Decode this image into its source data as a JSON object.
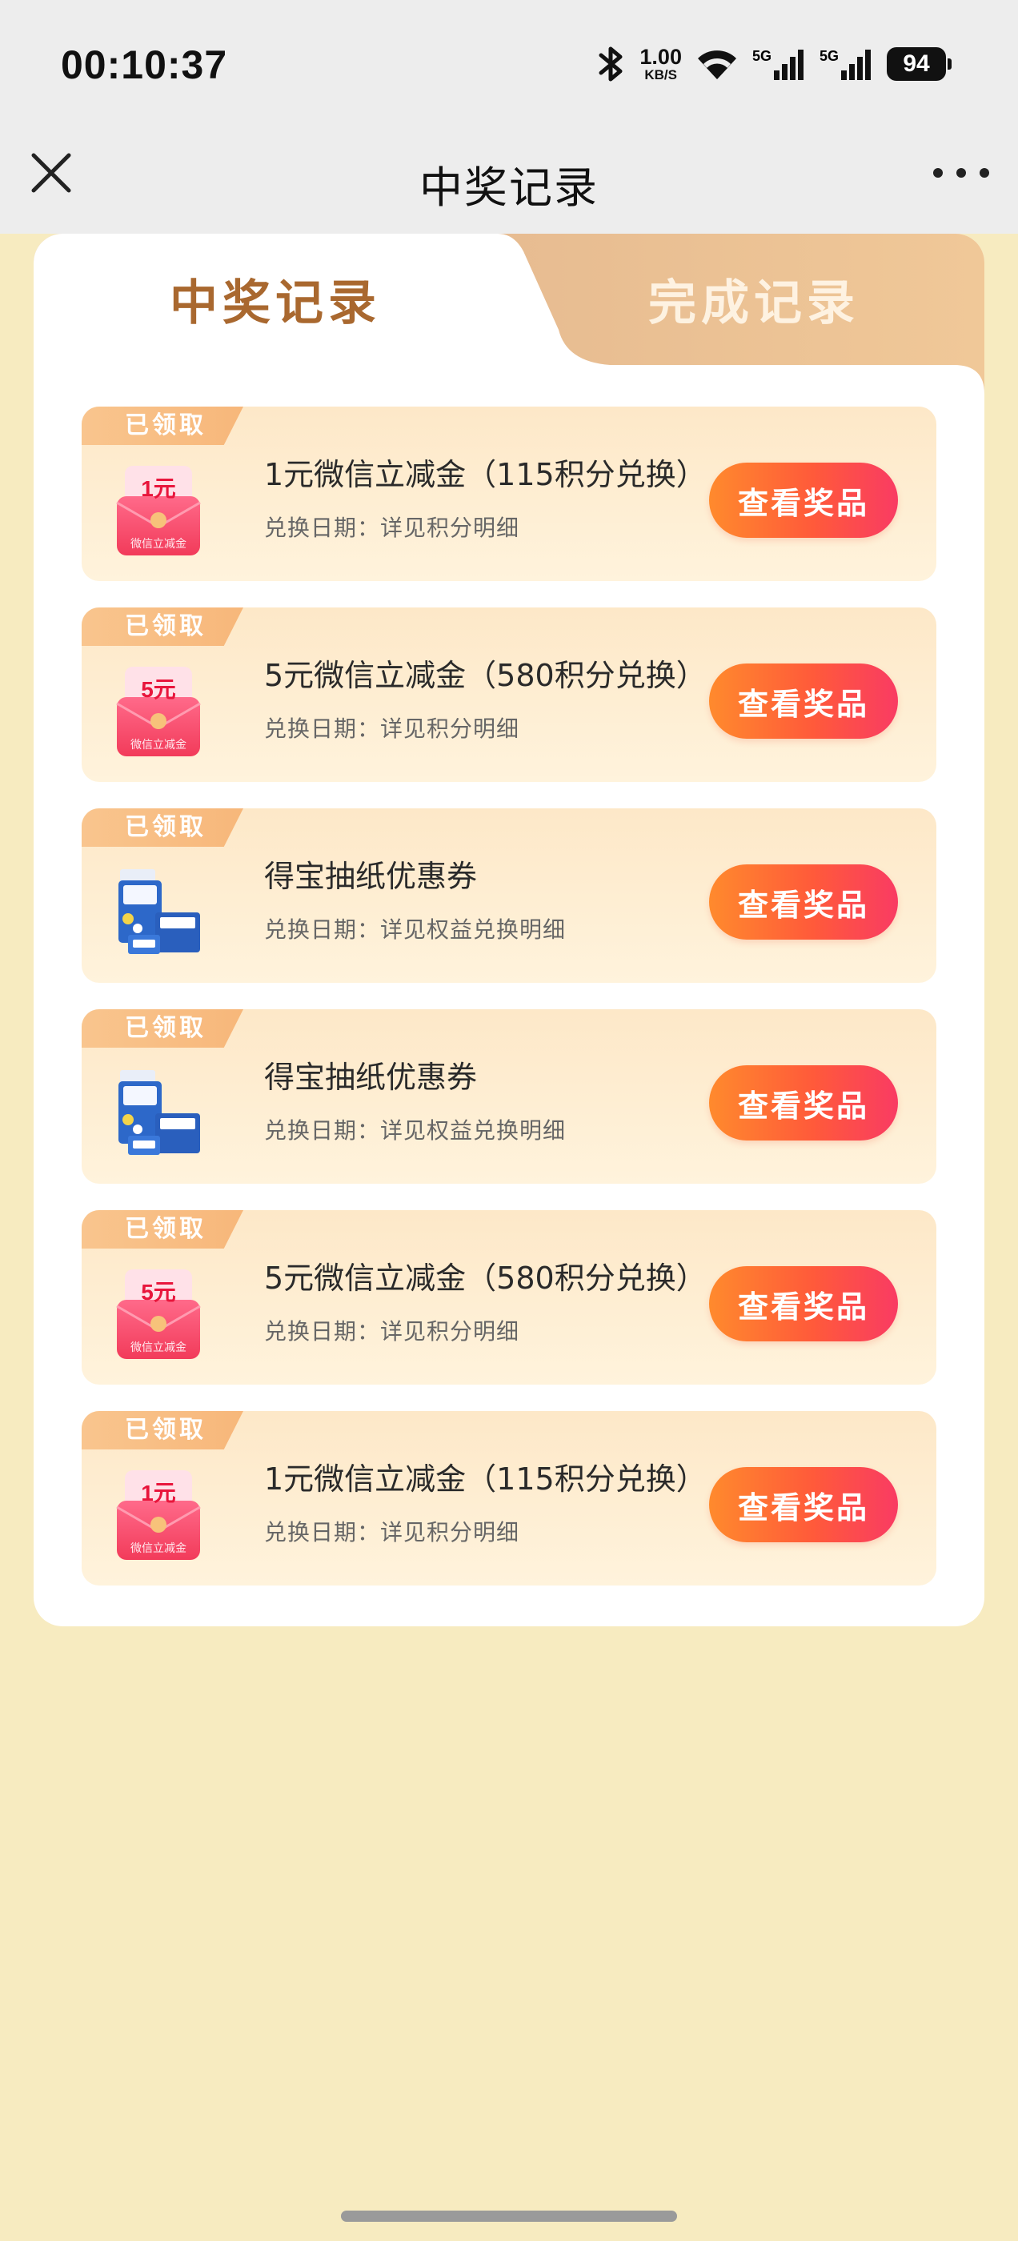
{
  "status_bar": {
    "time": "00:10:37",
    "net_speed_value": "1.00",
    "net_speed_unit": "KB/S",
    "sim1": "5G",
    "sim2": "5G",
    "battery": "94"
  },
  "nav": {
    "title": "中奖记录"
  },
  "tabs": [
    {
      "label": "中奖记录",
      "active": true
    },
    {
      "label": "完成记录",
      "active": false
    }
  ],
  "records": [
    {
      "badge": "已领取",
      "title": "1元微信立减金（115积分兑换）",
      "date": "兑换日期：详见积分明细",
      "button": "查看奖品",
      "image": "wechat-voucher",
      "amount": "1元",
      "img_caption": "微信立减金"
    },
    {
      "badge": "已领取",
      "title": "5元微信立减金（580积分兑换）",
      "date": "兑换日期：详见积分明细",
      "button": "查看奖品",
      "image": "wechat-voucher",
      "amount": "5元",
      "img_caption": "微信立减金"
    },
    {
      "badge": "已领取",
      "title": "得宝抽纸优惠券",
      "date": "兑换日期：详见权益兑换明细",
      "button": "查看奖品",
      "image": "tissue-pack"
    },
    {
      "badge": "已领取",
      "title": "得宝抽纸优惠券",
      "date": "兑换日期：详见权益兑换明细",
      "button": "查看奖品",
      "image": "tissue-pack"
    },
    {
      "badge": "已领取",
      "title": "5元微信立减金（580积分兑换）",
      "date": "兑换日期：详见积分明细",
      "button": "查看奖品",
      "image": "wechat-voucher",
      "amount": "5元",
      "img_caption": "微信立减金"
    },
    {
      "badge": "已领取",
      "title": "1元微信立减金（115积分兑换）",
      "date": "兑换日期：详见积分明细",
      "button": "查看奖品",
      "image": "wechat-voucher",
      "amount": "1元",
      "img_caption": "微信立减金"
    }
  ],
  "colors": {
    "page_bg": "#f7ebc0",
    "accent_tab": "#a9682f",
    "button_gradient_start": "#ff8a2d",
    "button_gradient_end": "#f93b63"
  }
}
